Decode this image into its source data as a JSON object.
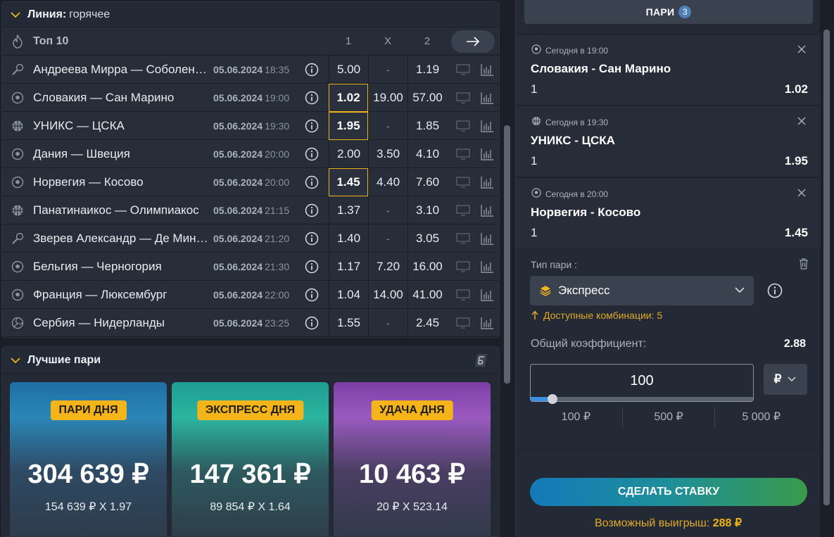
{
  "line": {
    "title": "Линия:",
    "subtitle": "горячее",
    "top_label": "Топ 10",
    "col1": "1",
    "colx": "X",
    "col2": "2",
    "events": [
      {
        "sport": "tennis",
        "name": "Андреева Мирра — Соболенко Арина",
        "date": "05.06.2024",
        "time": "18:35",
        "o1": "5.00",
        "ox": "-",
        "o2": "1.19",
        "sel": ""
      },
      {
        "sport": "football",
        "name": "Словакия — Сан Марино",
        "date": "05.06.2024",
        "time": "19:00",
        "o1": "1.02",
        "ox": "19.00",
        "o2": "57.00",
        "sel": "1"
      },
      {
        "sport": "basketball",
        "name": "УНИКС — ЦСКА",
        "date": "05.06.2024",
        "time": "19:30",
        "o1": "1.95",
        "ox": "-",
        "o2": "1.85",
        "sel": "1"
      },
      {
        "sport": "football",
        "name": "Дания — Швеция",
        "date": "05.06.2024",
        "time": "20:00",
        "o1": "2.00",
        "ox": "3.50",
        "o2": "4.10",
        "sel": ""
      },
      {
        "sport": "football",
        "name": "Норвегия — Косово",
        "date": "05.06.2024",
        "time": "20:00",
        "o1": "1.45",
        "ox": "4.40",
        "o2": "7.60",
        "sel": "1"
      },
      {
        "sport": "basketball",
        "name": "Панатинаикос — Олимпиакос",
        "date": "05.06.2024",
        "time": "21:15",
        "o1": "1.37",
        "ox": "-",
        "o2": "3.10",
        "sel": ""
      },
      {
        "sport": "tennis",
        "name": "Зверев Александр — Де Минаур Алекс",
        "date": "05.06.2024",
        "time": "21:20",
        "o1": "1.40",
        "ox": "-",
        "o2": "3.05",
        "sel": ""
      },
      {
        "sport": "football",
        "name": "Бельгия — Черногория",
        "date": "05.06.2024",
        "time": "21:30",
        "o1": "1.17",
        "ox": "7.20",
        "o2": "16.00",
        "sel": ""
      },
      {
        "sport": "football",
        "name": "Франция — Люксембург",
        "date": "05.06.2024",
        "time": "22:00",
        "o1": "1.04",
        "ox": "14.00",
        "o2": "41.00",
        "sel": ""
      },
      {
        "sport": "volleyball",
        "name": "Сербия — Нидерланды",
        "date": "05.06.2024",
        "time": "23:25",
        "o1": "1.55",
        "ox": "-",
        "o2": "2.45",
        "sel": ""
      }
    ]
  },
  "best": {
    "title": "Лучшие пари",
    "cards": [
      {
        "badge": "ПАРИ ДНЯ",
        "amount": "304 639 ₽",
        "formula": "154 639 ₽ X 1.97"
      },
      {
        "badge": "ЭКСПРЕСС ДНЯ",
        "amount": "147 361 ₽",
        "formula": "89 854 ₽ X 1.64"
      },
      {
        "badge": "УДАЧА ДНЯ",
        "amount": "10 463 ₽",
        "formula": "20 ₽ X 523.14"
      }
    ]
  },
  "slip": {
    "tab_label": "ПАРИ",
    "tab_count": "3",
    "bets": [
      {
        "when": "Сегодня в 19:00",
        "match": "Словакия - Сан Марино",
        "pick": "1",
        "coef": "1.02"
      },
      {
        "when": "Сегодня в 19:30",
        "match": "УНИКС - ЦСКА",
        "pick": "1",
        "coef": "1.95"
      },
      {
        "when": "Сегодня в 20:00",
        "match": "Норвегия - Косово",
        "pick": "1",
        "coef": "1.45"
      }
    ],
    "type_label": "Тип пари :",
    "type_value": "Экспресс",
    "combos": "Доступные комбинации: 5",
    "total_label": "Общий коэффициент:",
    "total_value": "2.88",
    "stake_value": "100",
    "currency": "₽",
    "quick": [
      "100 ₽",
      "500 ₽",
      "5 000 ₽"
    ],
    "place_label": "СДЕЛАТЬ СТАВКУ",
    "win_label": "Возможный выигрыш:",
    "win_value": "288 ₽"
  }
}
